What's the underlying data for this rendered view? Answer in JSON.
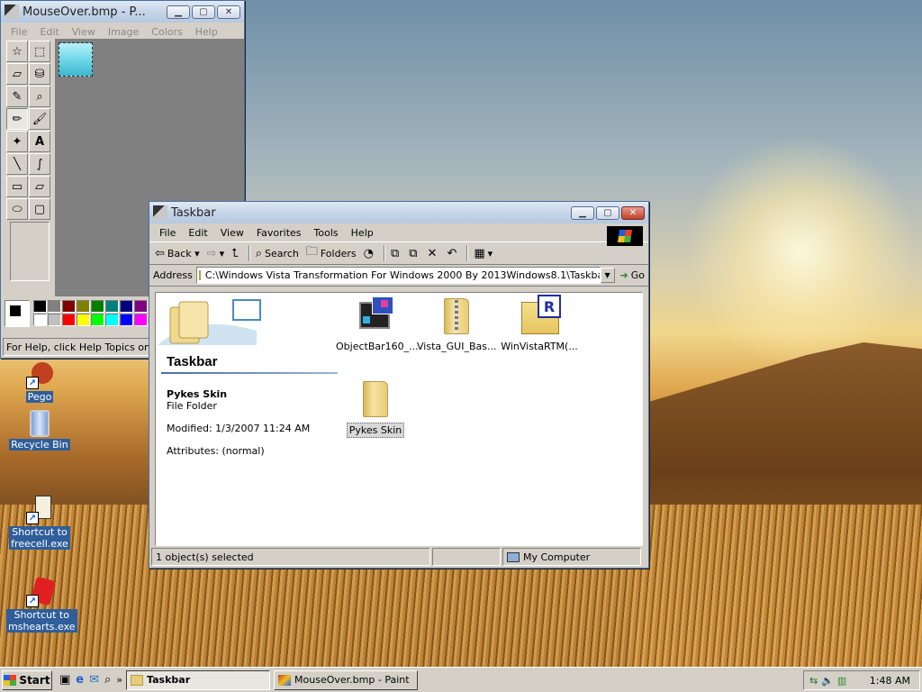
{
  "colors": {
    "title_gradient_top": "#dfe9f5",
    "selection_blue": "#2f5e9a",
    "face": "#d4d0c8"
  },
  "paint": {
    "title": "MouseOver.bmp - P...",
    "menu": [
      "File",
      "Edit",
      "View",
      "Image",
      "Colors",
      "Help"
    ],
    "status": "For Help, click Help Topics on the"
  },
  "explorer": {
    "title": "Taskbar",
    "menu": [
      "File",
      "Edit",
      "View",
      "Favorites",
      "Tools",
      "Help"
    ],
    "toolbar": {
      "back": "Back",
      "search": "Search",
      "folders": "Folders"
    },
    "address_label": "Address",
    "address_value": "C:\\Windows Vista Transformation For Windows 2000 By 2013Windows8.1\\Taskbar",
    "go": "Go",
    "webview": {
      "folder_title": "Taskbar",
      "item_name": "Pykes Skin",
      "item_type": "File Folder",
      "modified": "Modified: 1/3/2007 11:24 AM",
      "attributes": "Attributes: (normal)"
    },
    "items": [
      {
        "label": "ObjectBar160_...",
        "icon": "objectbar-app-icon"
      },
      {
        "label": "Vista_GUI_Bas...",
        "icon": "zip-folder-icon"
      },
      {
        "label": "WinVistaRTM(...",
        "icon": "winrar-archive-icon"
      },
      {
        "label": "Pykes Skin",
        "icon": "folder-icon"
      }
    ],
    "status": {
      "left": "1 object(s) selected",
      "zone": "My Computer"
    }
  },
  "desktop": [
    {
      "label": "Pego"
    },
    {
      "label": "Recycle Bin"
    },
    {
      "label_1": "Shortcut to",
      "label_2": "freecell.exe"
    },
    {
      "label_1": "Shortcut to",
      "label_2": "mshearts.exe"
    }
  ],
  "taskbar": {
    "start": "Start",
    "tasks": [
      "Taskbar",
      "MouseOver.bmp - Paint"
    ],
    "clock": "1:48 AM"
  }
}
